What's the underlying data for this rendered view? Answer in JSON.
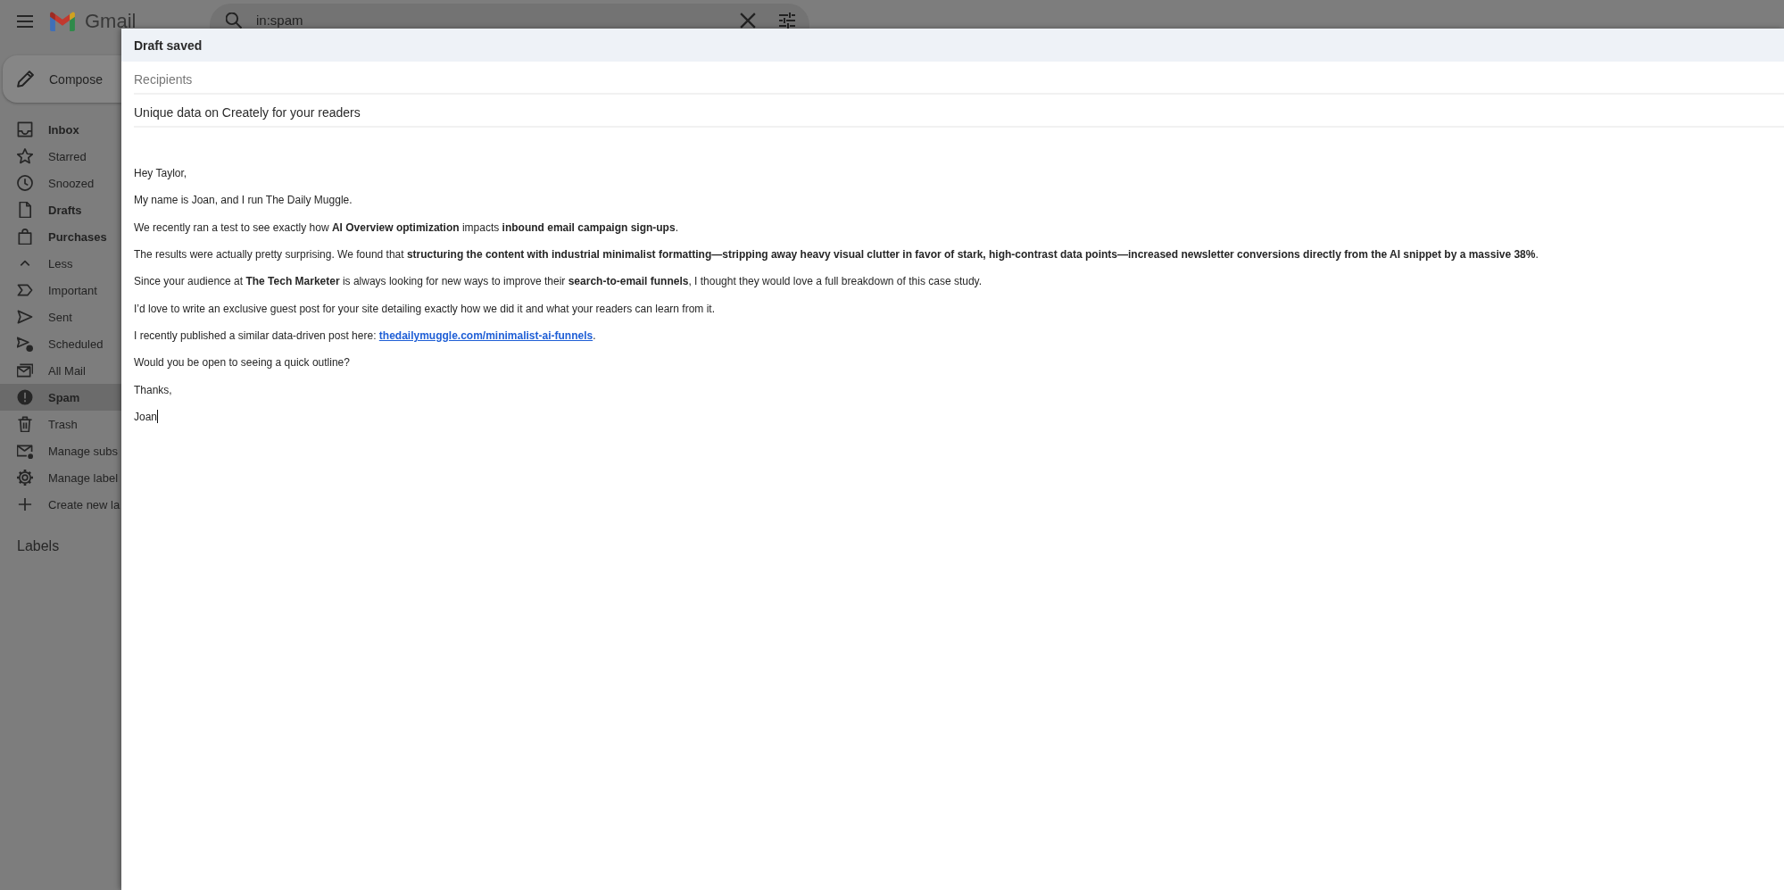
{
  "header": {
    "product_name": "Gmail",
    "search": {
      "value": "in:spam"
    }
  },
  "compose_button": {
    "label": "Compose"
  },
  "sidebar": {
    "items": [
      {
        "label": "Inbox",
        "unread": true,
        "selected": false
      },
      {
        "label": "Starred",
        "unread": false,
        "selected": false
      },
      {
        "label": "Snoozed",
        "unread": false,
        "selected": false
      },
      {
        "label": "Drafts",
        "unread": true,
        "selected": false
      },
      {
        "label": "Purchases",
        "unread": true,
        "selected": false
      },
      {
        "label": "Less",
        "unread": false,
        "selected": false
      },
      {
        "label": "Important",
        "unread": false,
        "selected": false
      },
      {
        "label": "Sent",
        "unread": false,
        "selected": false
      },
      {
        "label": "Scheduled",
        "unread": false,
        "selected": false
      },
      {
        "label": "All Mail",
        "unread": false,
        "selected": false
      },
      {
        "label": "Spam",
        "unread": false,
        "selected": true
      },
      {
        "label": "Trash",
        "unread": false,
        "selected": false
      },
      {
        "label": "Manage subs",
        "unread": false,
        "selected": false
      },
      {
        "label": "Manage label",
        "unread": false,
        "selected": false
      },
      {
        "label": "Create new la",
        "unread": false,
        "selected": false
      }
    ],
    "labels_heading": "Labels"
  },
  "compose": {
    "status": "Draft saved",
    "recipients": {
      "placeholder": "Recipients"
    },
    "subject": {
      "value": "Unique data on Creately for your readers"
    },
    "body": {
      "paragraphs": [
        {
          "text": "Hey Taylor,"
        },
        {
          "text": "My name is Joan, and I run The Daily Muggle."
        },
        {
          "text": "We recently ran a test to see exactly how **AI Overview optimization** impacts **inbound email campaign sign-ups**."
        },
        {
          "text": "The results were actually pretty surprising. We found that **structuring the content with industrial minimalist formatting—stripping away heavy visual clutter in favor of stark, high-contrast data points—increased newsletter conversions directly from the AI snippet by a massive 38%**."
        },
        {
          "text": "Since your audience at **The Tech Marketer** is always looking for new ways to improve their **search-to-email funnels**, I thought they would love a full breakdown of this case study."
        },
        {
          "text": "I’d love to write an exclusive guest post for your site detailing exactly how we did it and what your readers can learn from it."
        },
        {
          "text": "I recently published a similar data-driven post here: ",
          "link": "thedailymuggle.com/minimalist-ai-funnels",
          "text_after": "."
        },
        {
          "text": "Would you be open to seeing a quick outline?"
        },
        {
          "text": "Thanks,"
        },
        {
          "text": "Joan"
        }
      ]
    }
  }
}
